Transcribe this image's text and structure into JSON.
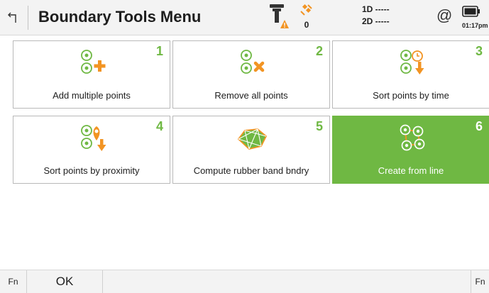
{
  "header": {
    "title": "Boundary Tools Menu",
    "satellite_count": "0",
    "dist_1d": "1D -----",
    "dist_2d": "2D -----",
    "at_symbol": "@",
    "time": "01:17pm"
  },
  "tiles": [
    {
      "number": "1",
      "label": "Add multiple points",
      "icon": "add-points-icon"
    },
    {
      "number": "2",
      "label": "Remove all points",
      "icon": "remove-points-icon"
    },
    {
      "number": "3",
      "label": "Sort points by time",
      "icon": "sort-by-time-icon"
    },
    {
      "number": "4",
      "label": "Sort points by proximity",
      "icon": "sort-by-proximity-icon"
    },
    {
      "number": "5",
      "label": "Compute rubber band bndry",
      "icon": "rubber-band-icon"
    },
    {
      "number": "6",
      "label": "Create from line",
      "icon": "create-from-line-icon",
      "selected": true
    }
  ],
  "footer": {
    "fn_left": "Fn",
    "ok": "OK",
    "fn_right": "Fn"
  },
  "colors": {
    "accent_green": "#6fb843",
    "accent_orange": "#f29423",
    "selected_tile": "#6fb843"
  }
}
